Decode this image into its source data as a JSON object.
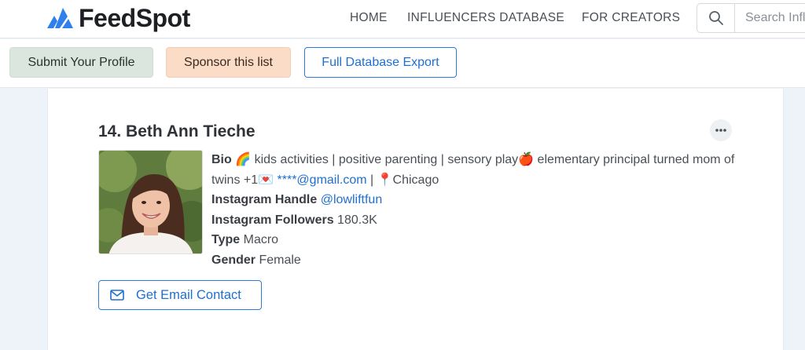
{
  "brand": {
    "name": "FeedSpot",
    "color": "#2f80ed"
  },
  "nav": {
    "home": "HOME",
    "influencers": "INFLUENCERS DATABASE",
    "creators": "FOR CREATORS"
  },
  "search": {
    "placeholder": "Search Influencers",
    "icon": "search-icon"
  },
  "actions": {
    "submit": "Submit Your Profile",
    "sponsor": "Sponsor this list",
    "export": "Full Database Export"
  },
  "profile": {
    "rank_name": "14. Beth Ann Tieche",
    "bio_label": "Bio",
    "bio_text_1": "🌈 kids activities | positive parenting | sensory play🍎 elementary principal turned mom of twins +1💌 ",
    "bio_email": "****@gmail.com",
    "bio_text_2": " | 📍Chicago",
    "handle_label": "Instagram Handle",
    "handle": "@lowliftfun",
    "followers_label": "Instagram Followers",
    "followers": "180.3K",
    "type_label": "Type",
    "type": "Macro",
    "gender_label": "Gender",
    "gender": "Female",
    "email_button": "Get Email Contact"
  }
}
